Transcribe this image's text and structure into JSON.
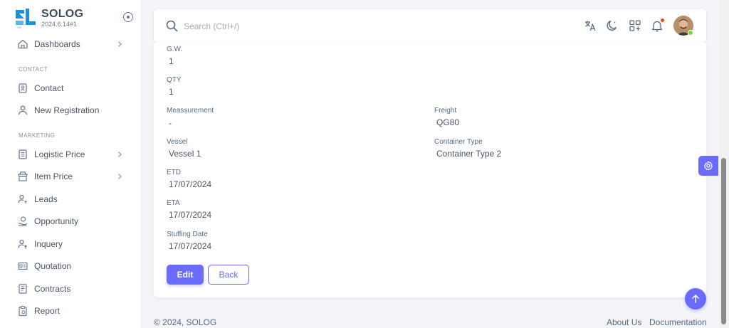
{
  "brand": {
    "name": "SOLOG",
    "version": "2024.6.14#1",
    "accent": "#696cff"
  },
  "sidebar": {
    "dashboards": "Dashboards",
    "contact_header": "CONTACT",
    "contact": "Contact",
    "new_registration": "New Registration",
    "marketing_header": "MARKETING",
    "logistic_price": "Logistic Price",
    "item_price": "Item Price",
    "leads": "Leads",
    "opportunity": "Opportunity",
    "inquery": "Inquery",
    "quotation": "Quotation",
    "contracts": "Contracts",
    "report": "Report"
  },
  "topbar": {
    "search_placeholder": "Search (Ctrl+/)",
    "icons": [
      "translate-icon",
      "moon-icon",
      "apps-icon",
      "bell-icon"
    ]
  },
  "details": {
    "gw_label": "G.W.",
    "gw_value": "1",
    "qty_label": "QTY",
    "qty_value": "1",
    "measurement_label": "Meassurement",
    "measurement_value": "-",
    "freight_label": "Freight",
    "freight_value": "QG80",
    "vessel_label": "Vessel",
    "vessel_value": "Vessel 1",
    "container_type_label": "Container Type",
    "container_type_value": "Container Type 2",
    "etd_label": "ETD",
    "etd_value": "17/07/2024",
    "eta_label": "ETA",
    "eta_value": "17/07/2024",
    "stuffing_label": "Stuffing Date",
    "stuffing_value": "17/07/2024"
  },
  "actions": {
    "edit": "Edit",
    "back": "Back"
  },
  "footer": {
    "copyright": "© 2024, SOLOG",
    "about": "About Us",
    "documentation": "Documentation"
  }
}
